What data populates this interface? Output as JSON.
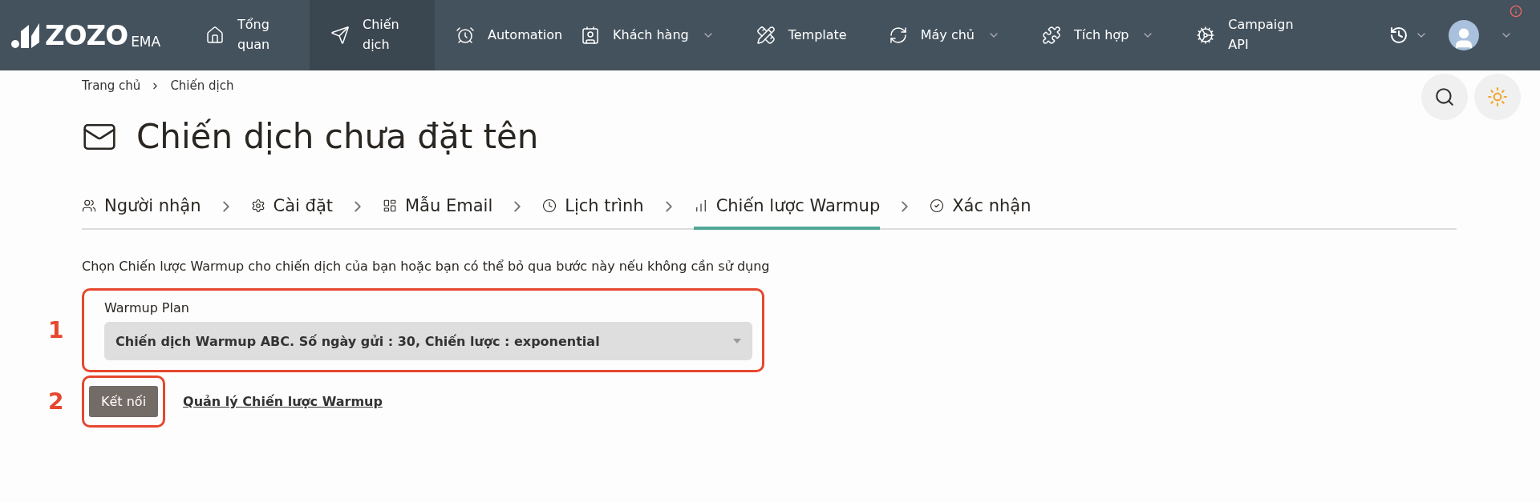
{
  "logo": {
    "main": "ZOZO",
    "sub": "EMA"
  },
  "nav": [
    {
      "kind": "home",
      "label": "Tổng quan",
      "selected": false,
      "dropdown": false
    },
    {
      "kind": "send",
      "label": "Chiến dịch",
      "selected": true,
      "dropdown": false
    },
    {
      "kind": "clock",
      "label": "Automation",
      "selected": false,
      "dropdown": false
    },
    {
      "kind": "contacts",
      "label": "Khách hàng",
      "selected": false,
      "dropdown": true
    },
    {
      "kind": "template",
      "label": "Template",
      "selected": false,
      "dropdown": false
    },
    {
      "kind": "server",
      "label": "Máy chủ",
      "selected": false,
      "dropdown": true
    },
    {
      "kind": "integration",
      "label": "Tích hợp",
      "selected": false,
      "dropdown": true
    },
    {
      "kind": "api",
      "label": "Campaign API",
      "selected": false,
      "dropdown": false
    }
  ],
  "breadcrumb": [
    "Trang chủ",
    "Chiến dịch"
  ],
  "title": "Chiến dịch chưa đặt tên",
  "steps": [
    {
      "kind": "people",
      "label": "Người nhận",
      "selected": false
    },
    {
      "kind": "gear",
      "label": "Cài đặt",
      "selected": false
    },
    {
      "kind": "layout",
      "label": "Mẫu Email",
      "selected": false
    },
    {
      "kind": "clock",
      "label": "Lịch trình",
      "selected": false
    },
    {
      "kind": "chart",
      "label": "Chiến lược Warmup",
      "selected": true
    },
    {
      "kind": "check",
      "label": "Xác nhận",
      "selected": false
    }
  ],
  "description": "Chọn Chiến lược Warmup cho chiến dịch của bạn hoặc bạn có thể bỏ qua bước này nếu không cần sử dụng",
  "plan": {
    "marker": "1",
    "label": "Warmup Plan",
    "value": "Chiến dịch Warmup ABC. Số ngày gửi : 30, Chiến lược : exponential"
  },
  "actions": {
    "marker": "2",
    "button": "Kết nối",
    "link": "Quản lý Chiến lược Warmup"
  }
}
